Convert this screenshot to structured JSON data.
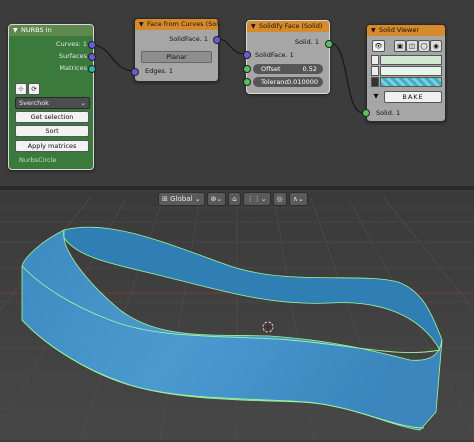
{
  "nodes": {
    "nurbs_in": {
      "title": "NURBS In",
      "outputs": [
        "Curves: 1",
        "Surfaces",
        "Matrices"
      ],
      "dropdown": "Sverchok",
      "buttons": [
        "Get selection",
        "Sort",
        "Apply matrices"
      ],
      "object_name": "NurbsCircle"
    },
    "face_from_curves": {
      "title": "Face from Curves (Soli...",
      "output": "SolidFace. 1",
      "mode_button": "Planar",
      "input": "Edges. 1"
    },
    "solidify_face": {
      "title": "Solidify Face (Solid)",
      "output": "Solid. 1",
      "input": "SolidFace. 1",
      "fields": [
        {
          "label": "Offset",
          "value": "0.52"
        },
        {
          "label": "Toleranc",
          "value": "0.010000"
        }
      ]
    },
    "solid_viewer": {
      "title": "Solid Viewer",
      "bake_label": "BAKE",
      "input": "Solid. 1"
    }
  },
  "viewport": {
    "orientation": "Global",
    "icons": [
      "orientation-icon",
      "pivot-icon",
      "snap-icon",
      "proportional-edit-icon"
    ]
  },
  "colors": {
    "node_header_orange": "#d78a2a",
    "node_header_green": "#5d8a4c",
    "socket_purple": "#6b5bd6",
    "socket_teal": "#2fb8a8",
    "socket_green": "#57c25a",
    "mesh_blue": "#3b8fc7",
    "mesh_edge": "#9ff59a"
  }
}
